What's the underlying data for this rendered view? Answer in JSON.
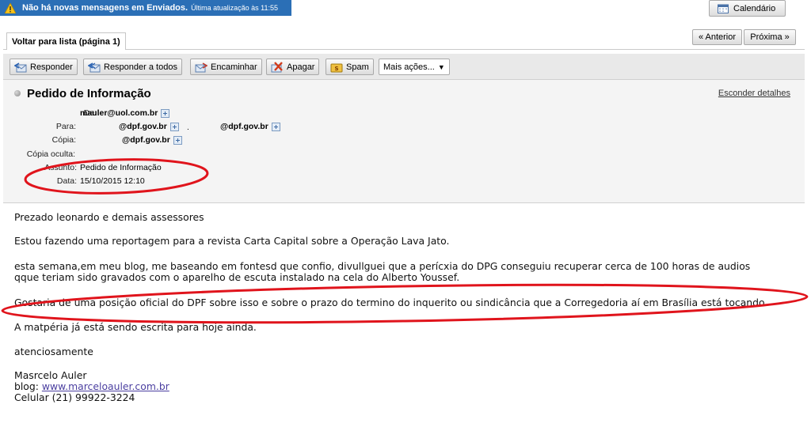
{
  "notification": {
    "text": "Não há novas mensagens em Enviados.",
    "updated": "Última atualização às 11:55"
  },
  "calendar_button": {
    "label": "Calendário"
  },
  "nav": {
    "back_tab": "Voltar para lista (página 1)",
    "previous": "« Anterior",
    "next": "Próxima »"
  },
  "toolbar": {
    "reply": "Responder",
    "reply_all": "Responder a todos",
    "forward": "Encaminhar",
    "delete": "Apagar",
    "spam": "Spam",
    "more": "Mais ações..."
  },
  "message": {
    "subject": "Pedido de Informação",
    "hide_details": "Esconder detalhes",
    "labels": {
      "from": "De:",
      "to": "Para:",
      "cc": "Cópia:",
      "bcc": "Cópia oculta:",
      "subject": "Assunto:",
      "date": "Data:"
    },
    "from": "mauler@uol.com.br",
    "to": [
      "@dpf.gov.br",
      "@dpf.gov.br"
    ],
    "cc": "@dpf.gov.br",
    "subject_value": "Pedido de Informação",
    "date": "15/10/2015 12:10"
  },
  "body": {
    "greeting": "Prezado leonardo e demais assessores",
    "p1": "Estou fazendo uma reportagem para a revista Carta Capital sobre a Operação Lava Jato.",
    "p2_line1": "esta semana,em meu blog, me baseando em fontesd que confio, divullguei que a perícxia do DPG conseguiu recuperar cerca de 100 horas de audios",
    "p2_line2": "qque teriam sido gravados com o aparelho de escuta instalado na cela do Alberto Youssef.",
    "p3": "Gostaria de uma posição oficial do DPF sobre isso e sobre o prazo do termino do inquerito ou sindicância que a Corregedoria aí em Brasília está tocando",
    "p4": "A matpéria já está sendo escrita para hoje ainda.",
    "closing": "atenciosamente",
    "sig_name": "Masrcelo Auler",
    "sig_blog_label": "blog: ",
    "sig_blog_link": "www.marceloauler.com.br",
    "sig_phone": "Celular (21) 99922-3224"
  },
  "colors": {
    "notification_bg": "#2b6fb6",
    "annotation_red": "#e0141c",
    "link": "#4b3fa0"
  }
}
